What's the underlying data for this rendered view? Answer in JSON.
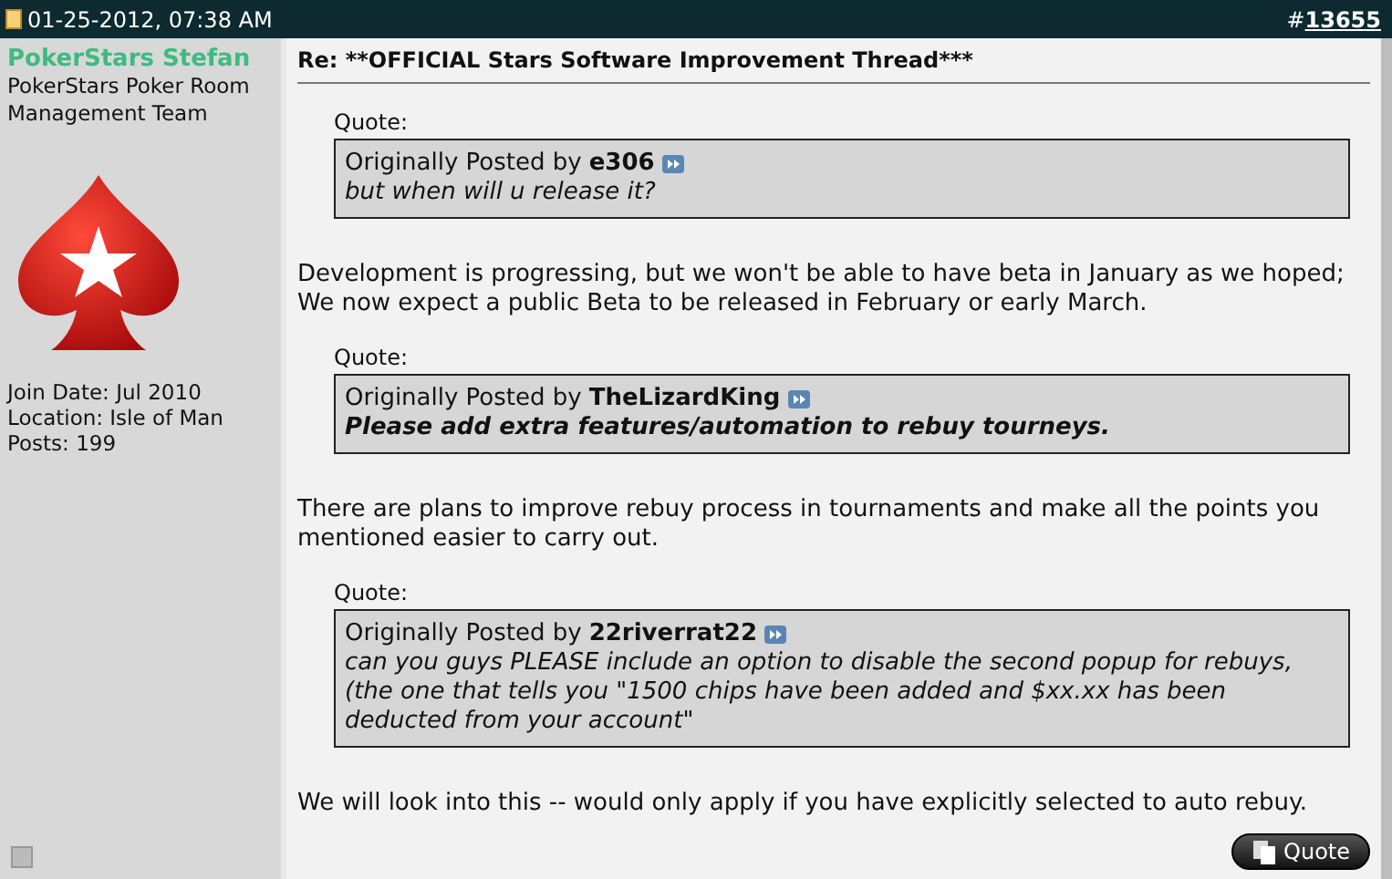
{
  "header": {
    "date": "01-25-2012, 07:38 AM",
    "post_number_prefix": "#",
    "post_number": "13655"
  },
  "author": {
    "name": "PokerStars Stefan",
    "title": "PokerStars Poker Room Management Team",
    "join_date": "Join Date: Jul 2010",
    "location": "Location: Isle of Man",
    "posts": "Posts: 199",
    "online": false
  },
  "post": {
    "title": "Re: **OFFICIAL Stars Software Improvement Thread***",
    "blocks": [
      {
        "kind": "quote",
        "label": "Quote:",
        "posted_by": "Originally Posted by",
        "user": "e306",
        "text": "but when will u release it?",
        "bold": false
      },
      {
        "kind": "paragraph",
        "text": "Development is progressing, but we won't be able to have beta in January as we hoped;\nWe now expect a public Beta to be released in February or early March."
      },
      {
        "kind": "quote",
        "label": "Quote:",
        "posted_by": "Originally Posted by",
        "user": "TheLizardKing",
        "text": "Please add extra features/automation to rebuy tourneys.",
        "bold": true
      },
      {
        "kind": "paragraph",
        "text": "There are plans to improve rebuy process in tournaments and make all the points you\nmentioned easier to carry out."
      },
      {
        "kind": "quote",
        "label": "Quote:",
        "posted_by": "Originally Posted by",
        "user": "22riverrat22",
        "text": "can you guys PLEASE include an option to disable the second popup for rebuys,\n(the one that tells you \"1500 chips have been added and $xx.xx has been\ndeducted from your account\"",
        "bold": false
      },
      {
        "kind": "paragraph",
        "text": "We will look into this -- would only apply if you have explicitly selected to auto rebuy."
      }
    ],
    "quote_button": "Quote"
  }
}
